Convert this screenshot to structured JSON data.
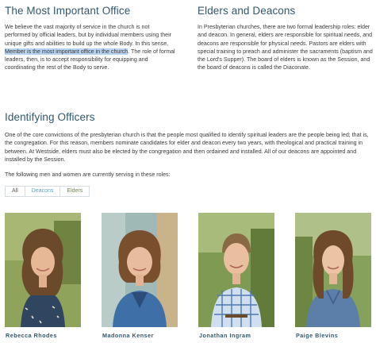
{
  "office": {
    "title": "The Most Important Office",
    "text_before": "We believe the vast majority of service in the church is not performed by official leaders, but by individual members using their unique gifts and abilities to build up the whole Body. In this sense, ",
    "highlight": "Member is the most important office in the church",
    "text_after": ". The role of formal leaders, then, is to accept responsibility for equipping and coordinating the rest of the Body to serve."
  },
  "elders": {
    "title": "Elders and Deacons",
    "text": "In Presbyterian churches, there are two formal leadership roles: elder and deacon. In general, elders are responsible for spiritual needs, and deacons are responsible for physical needs. Pastors are elders with special training to preach and administer the sacraments (baptism and the Lord's Supper). The board of elders is known as the Session, and the board of deacons is called the Diaconate."
  },
  "officers": {
    "title": "Identifying Officers",
    "text": "One of the core convictions of the presbyterian church is that the people most qualified to identify spiritual leaders are the people being led; that is, the congregation. For this reason, members nominate candidates for elder and deacon every two years, with theological and practical training in between. At Westside, elders must also be elected by the congregation and then ordained and installed. All of our deacons are appointed and installed by the Session.",
    "serving_text": "The following men and women are currently serving in these roles:",
    "filters": [
      "All",
      "Deacons",
      "Elders"
    ]
  },
  "people": [
    {
      "name": "Rebecca Rhodes",
      "photo": "woman-curly-hair-photo"
    },
    {
      "name": "Madonna Kenser",
      "photo": "woman-blue-cardigan-photo"
    },
    {
      "name": "Jonathan Ingram",
      "photo": "man-plaid-shirt-photo"
    },
    {
      "name": "Paige Blevins",
      "photo": "woman-denim-shirt-photo"
    }
  ],
  "colors": {
    "heading": "#31586c",
    "highlight": "#b7d3f2",
    "deacons_filter": "#5aa6c4",
    "elders_filter": "#6b8a3a"
  }
}
